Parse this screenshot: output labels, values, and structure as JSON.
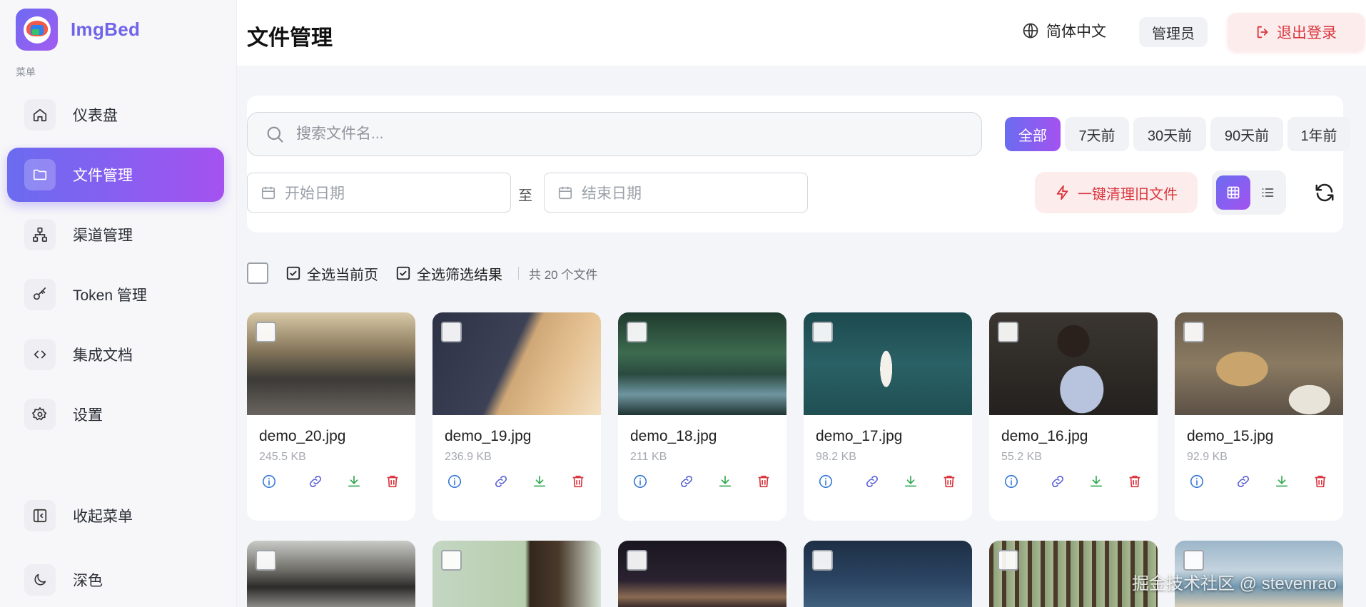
{
  "app": {
    "name": "ImgBed"
  },
  "sidebar": {
    "menu_label": "菜单",
    "items": [
      {
        "label": "仪表盘",
        "icon": "home-icon"
      },
      {
        "label": "文件管理",
        "icon": "folder-icon",
        "active": true
      },
      {
        "label": "渠道管理",
        "icon": "network-icon"
      },
      {
        "label": "Token 管理",
        "icon": "key-icon"
      },
      {
        "label": "集成文档",
        "icon": "code-icon"
      },
      {
        "label": "设置",
        "icon": "gear-icon"
      }
    ],
    "collapse_label": "收起菜单",
    "theme_label": "深色"
  },
  "header": {
    "title": "文件管理",
    "language": "简体中文",
    "role": "管理员",
    "logout_label": "退出登录"
  },
  "filters": {
    "search_placeholder": "搜索文件名...",
    "ranges": [
      {
        "label": "全部",
        "active": true
      },
      {
        "label": "7天前"
      },
      {
        "label": "30天前"
      },
      {
        "label": "90天前"
      },
      {
        "label": "1年前"
      }
    ],
    "start_date_placeholder": "开始日期",
    "to_label": "至",
    "end_date_placeholder": "结束日期",
    "clean_label": "一键清理旧文件"
  },
  "selection": {
    "select_page_label": "全选当前页",
    "select_filtered_label": "全选筛选结果",
    "count_text": "共 20 个文件"
  },
  "files": [
    {
      "name": "demo_20.jpg",
      "size": "245.5 KB"
    },
    {
      "name": "demo_19.jpg",
      "size": "236.9 KB"
    },
    {
      "name": "demo_18.jpg",
      "size": "211 KB"
    },
    {
      "name": "demo_17.jpg",
      "size": "98.2 KB"
    },
    {
      "name": "demo_16.jpg",
      "size": "55.2 KB"
    },
    {
      "name": "demo_15.jpg",
      "size": "92.9 KB"
    }
  ],
  "watermark": "掘金技术社区 @ stevenrao",
  "colors": {
    "accent_start": "#6a6cf0",
    "accent_end": "#a452f0",
    "danger": "#d9363e",
    "info": "#3a7bd5",
    "success": "#2fa84f"
  }
}
